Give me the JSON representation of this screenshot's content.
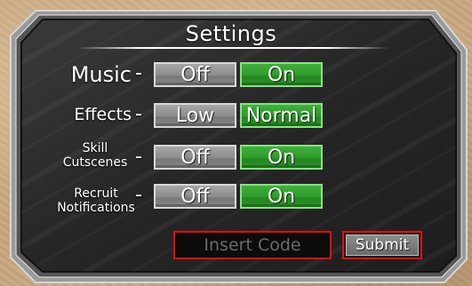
{
  "settings": {
    "title": "Settings",
    "rows": [
      {
        "label": "Music",
        "options": [
          "Off",
          "On"
        ],
        "selected": "On"
      },
      {
        "label": "Effects",
        "options": [
          "Low",
          "Normal"
        ],
        "selected": "Normal"
      },
      {
        "label_line1": "Skill",
        "label_line2": "Cutscenes",
        "options": [
          "Off",
          "On"
        ],
        "selected": "On"
      },
      {
        "label_line1": "Recruit",
        "label_line2": "Notifications",
        "options": [
          "Off",
          "On"
        ],
        "selected": "On"
      }
    ],
    "dash": "-",
    "code": {
      "placeholder": "Insert Code",
      "value": ""
    },
    "submit_label": "Submit"
  },
  "colors": {
    "selected": "#2f9a2c",
    "unselected": "#8a8a8a",
    "highlight_border": "#e01010",
    "panel": "#2b2b2b",
    "background": "#c9a882"
  }
}
